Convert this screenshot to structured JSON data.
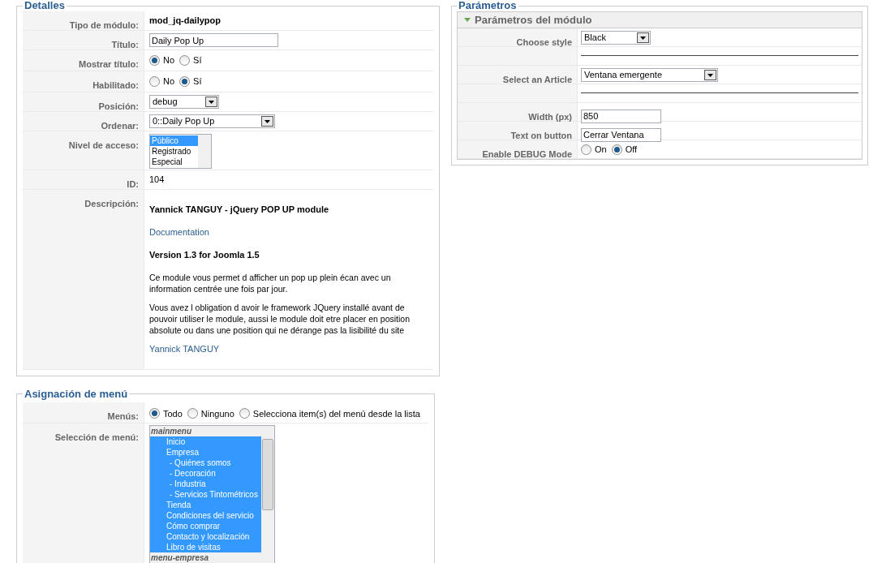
{
  "details": {
    "legend": "Detalles",
    "rows": [
      {
        "kind": "static",
        "label": "Tipo de módulo:",
        "value": "mod_jq-dailypop",
        "bold": true
      },
      {
        "kind": "text",
        "label": "Título:",
        "value": "Daily Pop Up"
      },
      {
        "kind": "radio",
        "label": "Mostrar título:",
        "options": [
          {
            "label": "No",
            "selected": true
          },
          {
            "label": "Sí",
            "selected": false
          }
        ]
      },
      {
        "kind": "radio",
        "label": "Habilitado:",
        "options": [
          {
            "label": "No",
            "selected": false
          },
          {
            "label": "Sí",
            "selected": true
          }
        ]
      },
      {
        "kind": "select",
        "label": "Posición:",
        "value": "debug"
      },
      {
        "kind": "select",
        "label": "Ordenar:",
        "value": "0::Daily Pop Up"
      },
      {
        "kind": "list",
        "label": "Nivel de acceso:",
        "options": [
          {
            "label": "Público",
            "selected": true
          },
          {
            "label": "Registrado",
            "selected": false
          },
          {
            "label": "Especial",
            "selected": false
          }
        ]
      },
      {
        "kind": "static",
        "label": "ID:",
        "value": "104",
        "bold": false
      },
      {
        "kind": "description",
        "label": "Descripción:",
        "paragraphs": [
          {
            "kind": "heading",
            "text": "Yannick TANGUY - jQuery POP UP module"
          },
          {
            "kind": "link",
            "text": "Documentation"
          },
          {
            "kind": "heading",
            "text": "Version 1.3 for Joomla 1.5"
          },
          {
            "kind": "text",
            "text": "Ce module vous permet d afficher un pop up plein écan avec un information centrée une fois par jour."
          },
          {
            "kind": "text",
            "text": "Vous avez l obligation d avoir le framework JQuery installé avant de pouvoir utiliser le module, aussi le module doit etre placer en position absolute ou dans une position qui ne dérange pas la lisibilité du site"
          },
          {
            "kind": "link",
            "text": "Yannick TANGUY"
          }
        ]
      }
    ]
  },
  "menu_assignment": {
    "legend": "Asignación de menú",
    "menus_label": "Menús:",
    "menus_options": [
      {
        "label": "Todo",
        "selected": true
      },
      {
        "label": "Ninguno",
        "selected": false
      },
      {
        "label": "Selecciona item(s) del menú desde la lista",
        "selected": false
      }
    ],
    "selection_label": "Selección de menú:",
    "groups": [
      {
        "name": "mainmenu",
        "items": [
          {
            "label": "Inicio",
            "selected": true
          },
          {
            "label": "Empresa",
            "selected": true,
            "children": [
              {
                "label": "- Quiénes somos",
                "selected": true
              },
              {
                "label": "- Decoración",
                "selected": true
              },
              {
                "label": "- Industria",
                "selected": true
              },
              {
                "label": "- Servicios Tintométricos",
                "selected": true
              }
            ]
          },
          {
            "label": "Tienda",
            "selected": true
          },
          {
            "label": "Condiciones del servicio",
            "selected": true
          },
          {
            "label": "Cómo comprar",
            "selected": true
          },
          {
            "label": "Contacto y localización",
            "selected": true
          },
          {
            "label": "Libro de visitas",
            "selected": true
          }
        ]
      },
      {
        "name": "menu-empresa"
      }
    ]
  },
  "parameters": {
    "legend": "Parámetros",
    "panel_title": "Parámetros del módulo",
    "expanded": true,
    "rows": [
      {
        "kind": "select",
        "label": "Choose style",
        "value": "Black"
      },
      {
        "kind": "separator"
      },
      {
        "kind": "select",
        "label": "Select an Article",
        "value": "Ventana emergente"
      },
      {
        "kind": "separator"
      },
      {
        "kind": "text",
        "label": "Width (px)",
        "value": "850"
      },
      {
        "kind": "text",
        "label": "Text on button",
        "value": "Cerrar Ventana"
      },
      {
        "kind": "radio",
        "label": "Enable DEBUG Mode",
        "options": [
          {
            "label": "On",
            "selected": false
          },
          {
            "label": "Off",
            "selected": true
          }
        ]
      }
    ]
  }
}
